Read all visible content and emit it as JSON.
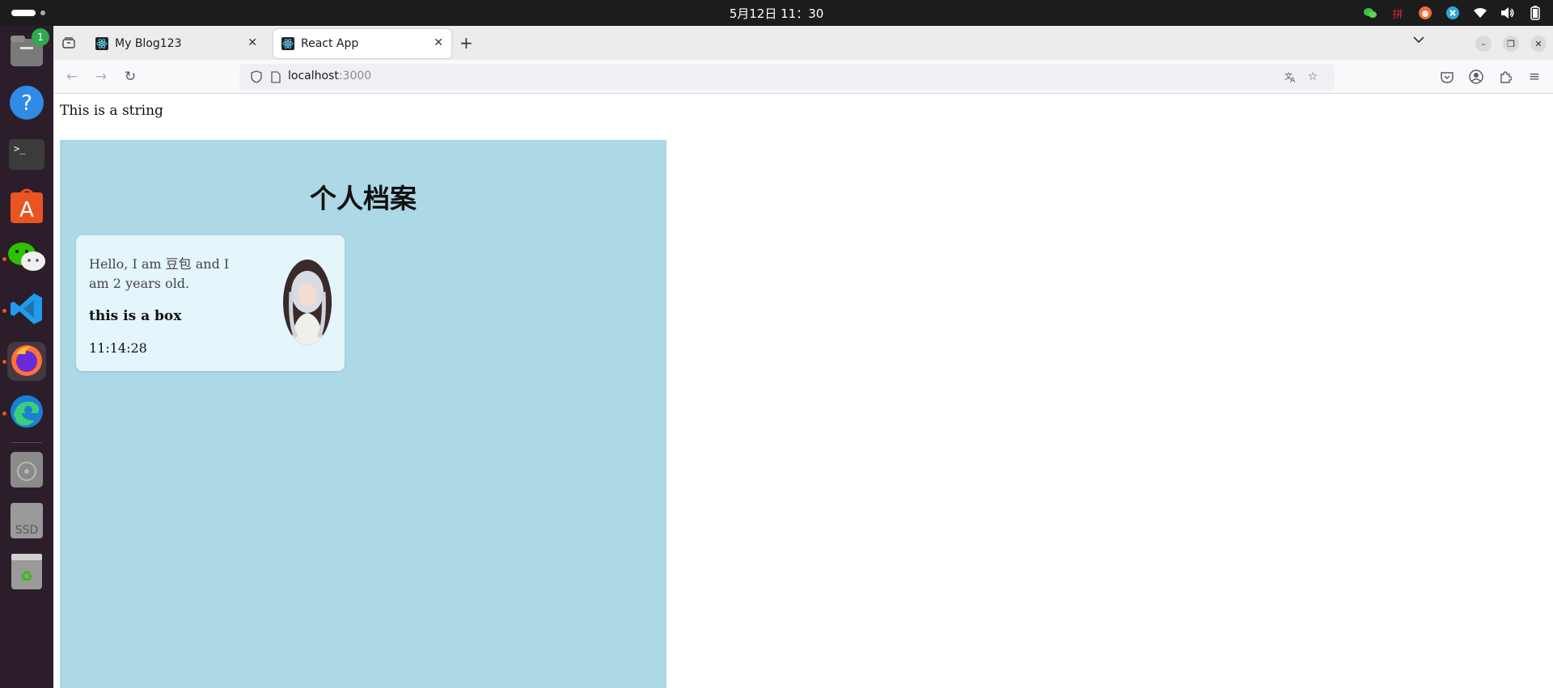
{
  "system": {
    "clock": "5月12日  11：30",
    "tray_icons": [
      "wechat-icon",
      "input-method-icon",
      "cat-icon",
      "sync-icon",
      "wifi-icon",
      "volume-icon",
      "battery-icon"
    ],
    "input_method_label": "拼"
  },
  "dock": {
    "items": [
      {
        "name": "files-icon",
        "badge": "1"
      },
      {
        "name": "help-icon"
      },
      {
        "name": "terminal-icon"
      },
      {
        "name": "app-store-icon"
      },
      {
        "name": "wechat-icon"
      },
      {
        "name": "vscode-icon"
      },
      {
        "name": "firefox-icon"
      },
      {
        "name": "edge-icon"
      },
      {
        "name": "optical-drive-icon"
      },
      {
        "name": "ssd-icon",
        "label": "SSD"
      },
      {
        "name": "trash-icon"
      }
    ]
  },
  "browser": {
    "tabs": [
      {
        "title": "My Blog123",
        "active": false
      },
      {
        "title": "React App",
        "active": true
      }
    ],
    "url_host": "localhost",
    "url_port": ":3000",
    "close_symbol": "✕",
    "new_tab_symbol": "+"
  },
  "page": {
    "top_string": "This is a string",
    "panel_title": "个人档案",
    "card": {
      "intro": "Hello, I am 豆包 and I am 2 years old.",
      "box_text": "this is a box",
      "time": "11:14:28"
    },
    "colors": {
      "panel_bg": "#add8e6",
      "card_bg": "#e4f5fb"
    }
  }
}
